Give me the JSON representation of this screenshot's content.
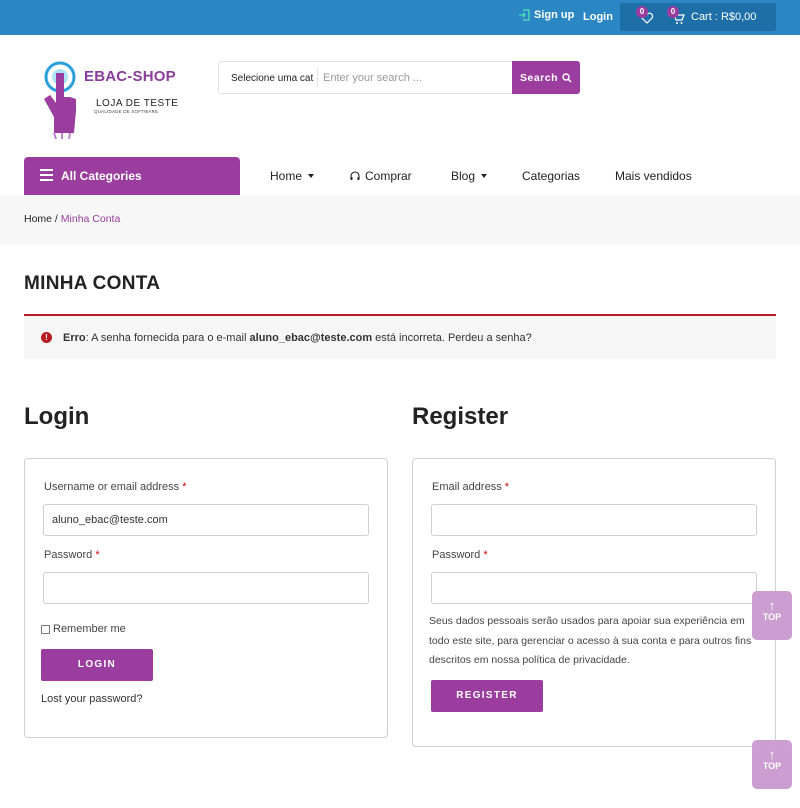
{
  "topbar": {
    "signup": "Sign up",
    "login": "Login",
    "wishlist_count": "0",
    "cart_count": "0",
    "cart_text": "Cart : R$0,00"
  },
  "logo": {
    "brand": "EBAC-SHOP",
    "tagline": "LOJA DE TESTE",
    "subtagline": "QUALIDADE DE SOFTWARE"
  },
  "search": {
    "category": "Selecione uma cat",
    "placeholder": "Enter your search ...",
    "button": "Search"
  },
  "nav": {
    "all_categories": "All Categories",
    "items": [
      "Home",
      "Comprar",
      "Blog",
      "Categorias",
      "Mais vendidos"
    ]
  },
  "breadcrumb": {
    "home": "Home",
    "separator": " / ",
    "current": "Minha Conta"
  },
  "page": {
    "title": "MINHA CONTA"
  },
  "error": {
    "label": "Erro",
    "before": ": A senha fornecida para o e-mail ",
    "email": "aluno_ebac@teste.com",
    "after": " está incorreta. Perdeu a senha?"
  },
  "login": {
    "title": "Login",
    "username_label": "Username or email address",
    "username_value": "aluno_ebac@teste.com",
    "password_label": "Password",
    "required_mark": "*",
    "remember": "Remember me",
    "button": "LOGIN",
    "lost_password": "Lost your password?"
  },
  "register": {
    "title": "Register",
    "email_label": "Email address",
    "password_label": "Password",
    "required_mark": "*",
    "privacy_text": "Seus dados pessoais serão usados para apoiar sua experiência em todo este site, para gerenciar o acesso à sua conta e para outros fins descritos em nossa política de privacidade.",
    "button": "REGISTER"
  },
  "totop": {
    "label": "TOP"
  },
  "colors": {
    "topbar": "#2b87c4",
    "accent": "#9b3d9e",
    "error": "#b81c23"
  }
}
